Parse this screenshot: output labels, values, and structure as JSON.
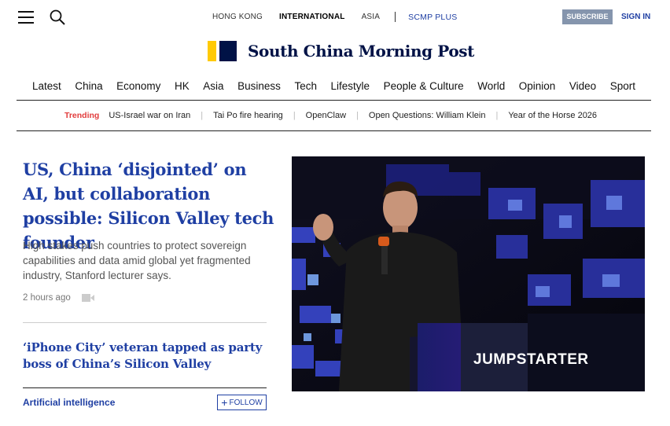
{
  "header": {
    "editions": [
      "HONG KONG",
      "INTERNATIONAL",
      "ASIA"
    ],
    "active_edition": "INTERNATIONAL",
    "plus_label": "SCMP PLUS",
    "subscribe_label": "SUBSCRIBE",
    "signin_label": "SIGN IN",
    "logo_text": "South China Morning Post"
  },
  "nav": {
    "sections": [
      "Latest",
      "China",
      "Economy",
      "HK",
      "Asia",
      "Business",
      "Tech",
      "Lifestyle",
      "People & Culture",
      "World",
      "Opinion",
      "Video",
      "Sport"
    ]
  },
  "trending": {
    "label": "Trending",
    "items": [
      "US-Israel war on Iran",
      "Tai Po fire hearing",
      "OpenClaw",
      "Open Questions: William Klein",
      "Year of the Horse 2026"
    ]
  },
  "lead": {
    "title": "US, China ‘disjointed’ on AI, but collaboration possible: Silicon Valley tech founder",
    "summary": "High stakes push countries to protect sovereign capabilities and data amid global yet fragmented industry, Stanford lecturer says.",
    "time": "2 hours ago",
    "image_caption_text": "JUMPSTARTER"
  },
  "second": {
    "title": "‘iPhone City’ veteran tapped as party boss of China’s Silicon Valley"
  },
  "topic": {
    "label": "Artificial intelligence",
    "follow_label": "FOLLOW"
  },
  "colors": {
    "brand_navy": "#001246",
    "brand_yellow": "#ffca05",
    "link_blue": "#1f3fa3",
    "trending_red": "#e23d3d"
  },
  "icons": [
    "menu-icon",
    "search-icon",
    "video-icon",
    "plus-icon"
  ]
}
